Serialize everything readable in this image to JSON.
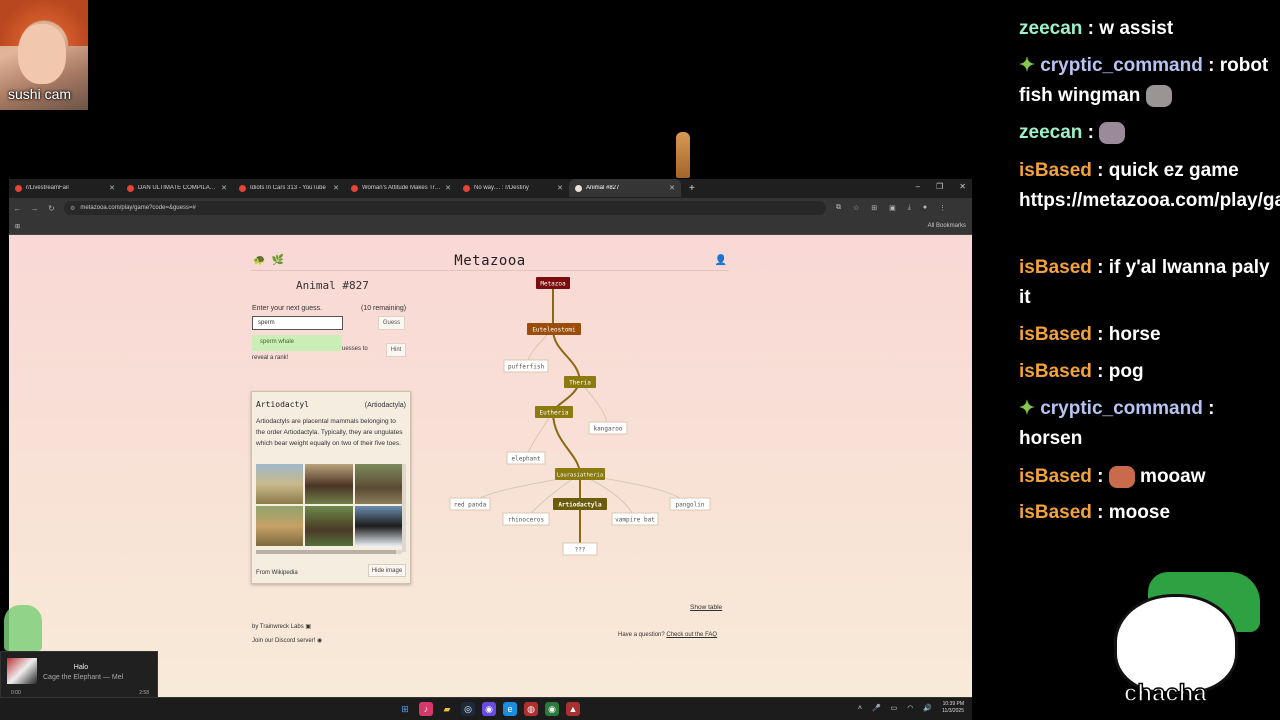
{
  "webcam": {
    "label": "sushi cam"
  },
  "browser": {
    "tabs": [
      {
        "label": "r/LivestreamFail",
        "active": false
      },
      {
        "label": "DAN ULTIMATE COMPILATION...",
        "active": false
      },
      {
        "label": "Idiots In Cars 313 - YouTube",
        "active": false
      },
      {
        "label": "Woman's Attitude Makes Traffi...",
        "active": false
      },
      {
        "label": "No way.... : r/Destiny",
        "active": false
      },
      {
        "label": "Animal #827",
        "active": true
      }
    ],
    "new_tab": "+",
    "window_controls": [
      "–",
      "❐",
      "✕"
    ],
    "url": "metazooa.com/play/game?code=&guess=#",
    "all_bookmarks": "All Bookmarks"
  },
  "page": {
    "brand": "Metazooa",
    "animal_title": "Animal #827",
    "prompt": "Enter your next guess.",
    "remaining": "(10 remaining)",
    "guess_value": "sperm",
    "guess_button": "Guess",
    "suggestion": "sperm whale",
    "hint_text_1": "uesses to",
    "hint_text_2": "reveal a rank!",
    "hint_button": "Hint",
    "card": {
      "title": "Artiodactyl",
      "tag": "(Artiodactyla)",
      "description": "Artiodactyls are placental mammals belonging to the order Artiodactyla. Typically, they are ungulates which bear weight equally on two of their five toes.",
      "source": "From Wikipedia",
      "hide_button": "Hide image"
    },
    "tree": {
      "nodes": [
        {
          "id": "metazoa",
          "label": "Metazoa",
          "kind": "clade"
        },
        {
          "id": "euteleostomi",
          "label": "Euteleostomi",
          "kind": "clade"
        },
        {
          "id": "pufferfish",
          "label": "pufferfish",
          "kind": "guess"
        },
        {
          "id": "theria",
          "label": "Theria",
          "kind": "clade"
        },
        {
          "id": "eutheria",
          "label": "Eutheria",
          "kind": "clade"
        },
        {
          "id": "kangaroo",
          "label": "kangaroo",
          "kind": "guess"
        },
        {
          "id": "elephant",
          "label": "elephant",
          "kind": "guess"
        },
        {
          "id": "laurasiatheria",
          "label": "Laurasiatheria",
          "kind": "clade"
        },
        {
          "id": "red_panda",
          "label": "red panda",
          "kind": "guess"
        },
        {
          "id": "rhinoceros",
          "label": "rhinoceros",
          "kind": "guess"
        },
        {
          "id": "artiodactyla",
          "label": "Artiodactyla",
          "kind": "clade"
        },
        {
          "id": "vampire_bat",
          "label": "vampire bat",
          "kind": "guess"
        },
        {
          "id": "pangolin",
          "label": "pangolin",
          "kind": "guess"
        },
        {
          "id": "unknown",
          "label": "???",
          "kind": "guess"
        }
      ]
    },
    "show_table": "Show table",
    "credit": "by Trainwreck Labs",
    "discord": "Join our Discord server!",
    "faq_prefix": "Have a question?",
    "faq_link": "Check out the FAQ"
  },
  "music": {
    "song": "Halo",
    "artist": "Cage the Elephant — Mel",
    "time_start": "0:00",
    "time_end": "2:58"
  },
  "taskbar": {
    "clock_time": "10:39 PM",
    "clock_date": "11/3/2025"
  },
  "chat": {
    "messages": [
      {
        "user": "zeecan",
        "text": "w assist",
        "color": "#9ef0c8",
        "badge": false
      },
      {
        "user": "cryptic_command",
        "text": "robot fish wingman",
        "color": "#b7c3f2",
        "badge": true,
        "emote": true
      },
      {
        "user": "zeecan",
        "text": "",
        "color": "#9ef0c8",
        "badge": false,
        "emote": true
      },
      {
        "user": "isBased",
        "text": "quick ez game https://metazooa.com/play/game",
        "color": "#f2a13b",
        "badge": false
      },
      {
        "user": "isBased",
        "text": "if y'al lwanna paly it",
        "color": "#f2a13b",
        "badge": false
      },
      {
        "user": "isBased",
        "text": "horse",
        "color": "#f2a13b",
        "badge": false
      },
      {
        "user": "isBased",
        "text": "pog",
        "color": "#f2a13b",
        "badge": false
      },
      {
        "user": "cryptic_command",
        "text": "horsen",
        "color": "#b7c3f2",
        "badge": true
      },
      {
        "user": "isBased",
        "text": "mooaw",
        "color": "#f2a13b",
        "badge": false,
        "emote_before": true
      },
      {
        "user": "isBased",
        "text": "moose",
        "color": "#f2a13b",
        "badge": false
      }
    ]
  },
  "overlay": {
    "chacha": "chacha"
  },
  "colors": {
    "clade_dark": "#7a0d0d",
    "clade_brown": "#9a4e0c",
    "clade_olive": "#8a7a10",
    "branch": "#8a6a10"
  }
}
